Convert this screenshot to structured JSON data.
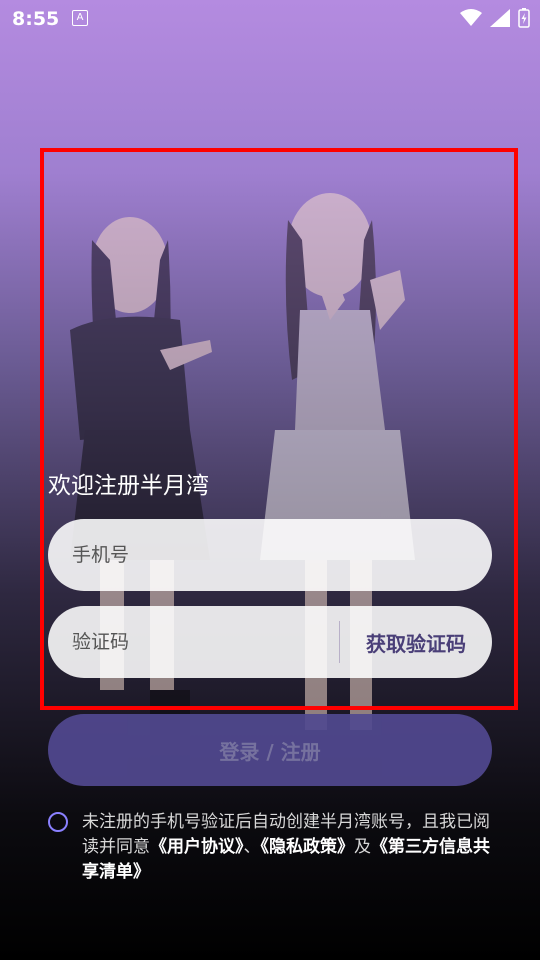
{
  "status_bar": {
    "time": "8:55",
    "notif_icon": "A",
    "icons": [
      "wifi-icon",
      "signal-icon",
      "battery-charging-icon"
    ]
  },
  "main": {
    "welcome": "欢迎注册半月湾",
    "phone_placeholder": "手机号",
    "code_placeholder": "验证码",
    "get_code_label": "获取验证码",
    "login_label": "登录 / 注册"
  },
  "agreement": {
    "text_1": "未注册的手机号验证后自动创建半月湾账号，且我已阅读并同意",
    "user_agreement": "《用户协议》",
    "sep_1": "、",
    "privacy_policy": "《隐私政策》",
    "sep_2": "及",
    "third_party": "《第三方信息共享清单》"
  },
  "colors": {
    "highlight_box": "#ff0000",
    "login_button": "#514990",
    "radio_border": "#8a80ff"
  }
}
